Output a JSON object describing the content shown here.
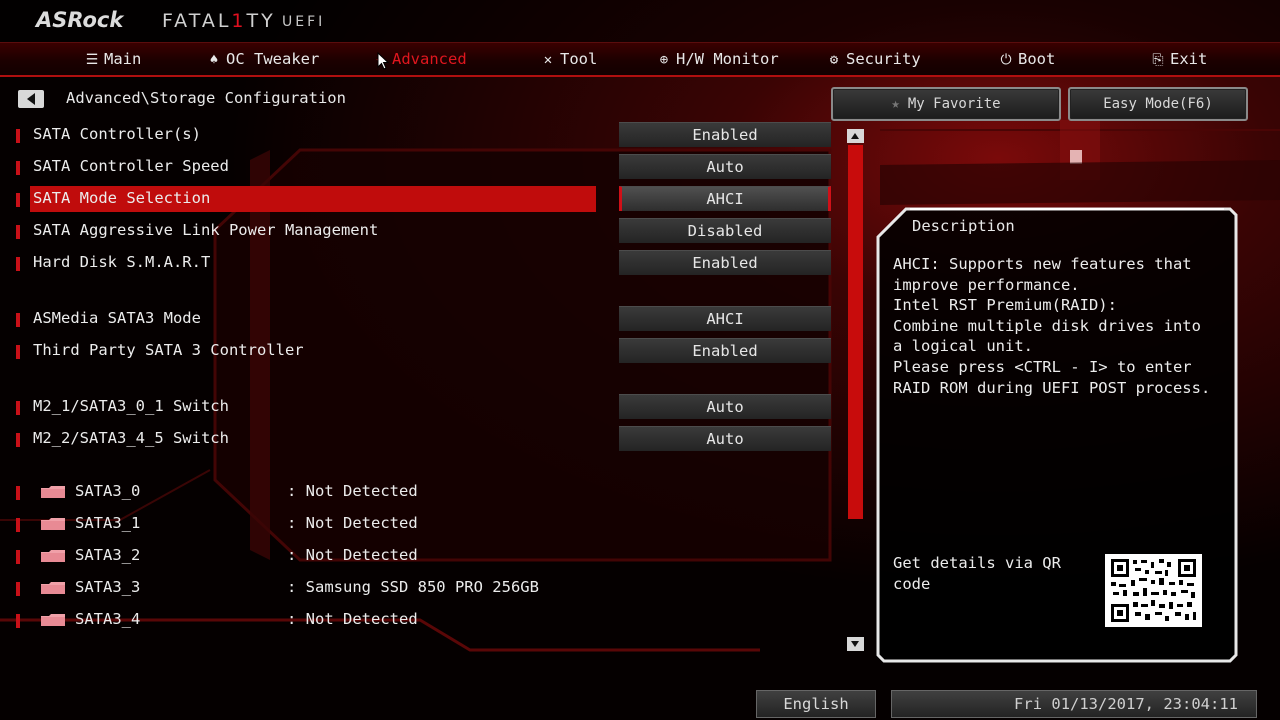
{
  "header": {
    "brand": "ASRock",
    "series_prefix": "FATAL",
    "series_highlight": "1",
    "series_suffix": "TY",
    "firmware": "UEFI"
  },
  "nav": {
    "items": [
      {
        "label": "Main",
        "icon": "list-icon"
      },
      {
        "label": "OC Tweaker",
        "icon": "rocket-icon"
      },
      {
        "label": "Advanced",
        "icon": "star-icon",
        "active": true
      },
      {
        "label": "Tool",
        "icon": "tools-icon"
      },
      {
        "label": "H/W Monitor",
        "icon": "monitor-icon"
      },
      {
        "label": "Security",
        "icon": "shield-icon"
      },
      {
        "label": "Boot",
        "icon": "power-icon"
      },
      {
        "label": "Exit",
        "icon": "exit-icon"
      }
    ]
  },
  "breadcrumb": "Advanced\\Storage Configuration",
  "favorites_label": "My Favorite",
  "easy_mode_label": "Easy Mode(F6)",
  "settings": [
    {
      "label": "SATA Controller(s)",
      "value": "Enabled"
    },
    {
      "label": "SATA Controller Speed",
      "value": "Auto"
    },
    {
      "label": "SATA Mode Selection",
      "value": "AHCI",
      "selected": true
    },
    {
      "label": "SATA Aggressive Link Power Management",
      "value": "Disabled"
    },
    {
      "label": "Hard Disk S.M.A.R.T",
      "value": "Enabled"
    },
    {
      "label": "ASMedia SATA3 Mode",
      "value": "AHCI"
    },
    {
      "label": "Third Party SATA 3 Controller",
      "value": "Enabled"
    },
    {
      "label": "M2_1/SATA3_0_1 Switch",
      "value": "Auto"
    },
    {
      "label": "M2_2/SATA3_4_5 Switch",
      "value": "Auto"
    }
  ],
  "drives": [
    {
      "name": "SATA3_0",
      "value": ": Not Detected"
    },
    {
      "name": "SATA3_1",
      "value": ": Not Detected"
    },
    {
      "name": "SATA3_2",
      "value": ": Not Detected"
    },
    {
      "name": "SATA3_3",
      "value": ": Samsung SSD 850 PRO 256GB"
    },
    {
      "name": "SATA3_4",
      "value": ": Not Detected"
    }
  ],
  "description": {
    "title": "Description",
    "text": "AHCI: Supports new features that\nimprove performance.\nIntel RST Premium(RAID):\nCombine multiple disk drives into\na logical unit.\nPlease press <CTRL - I> to enter\nRAID ROM during UEFI POST process.",
    "qr_label": "Get details via QR code"
  },
  "footer": {
    "language": "English",
    "datetime": "Fri 01/13/2017, 23:04:11"
  },
  "colors": {
    "accent": "#c00c0c",
    "active_tab": "#e0161e"
  }
}
